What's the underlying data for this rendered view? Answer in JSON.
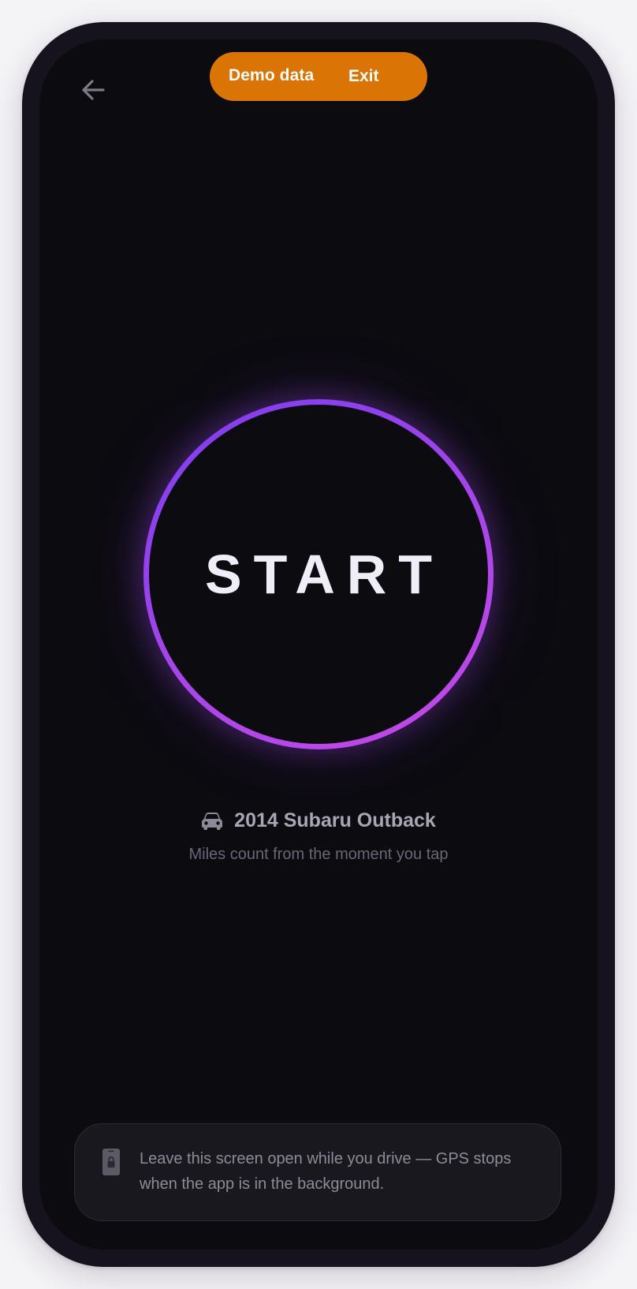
{
  "header": {
    "back_label": "Back",
    "demo_label": "Demo data",
    "exit_label": "Exit"
  },
  "start": {
    "label": "START"
  },
  "vehicle": {
    "icon": "car-icon",
    "name": "2014 Subaru Outback",
    "subtext": "Miles count from the moment you tap"
  },
  "info": {
    "icon": "phone-lock-icon",
    "text": "Leave this screen open while you drive — GPS stops when the app is in the background."
  },
  "colors": {
    "background": "#0c0b10",
    "frame": "#16131f",
    "accent_orange": "#da7405",
    "ring_start": "#7b3df0",
    "ring_end": "#c74ae6",
    "text_primary": "#efedf7",
    "text_secondary": "#a9a6b4",
    "text_muted": "#6a6777"
  }
}
